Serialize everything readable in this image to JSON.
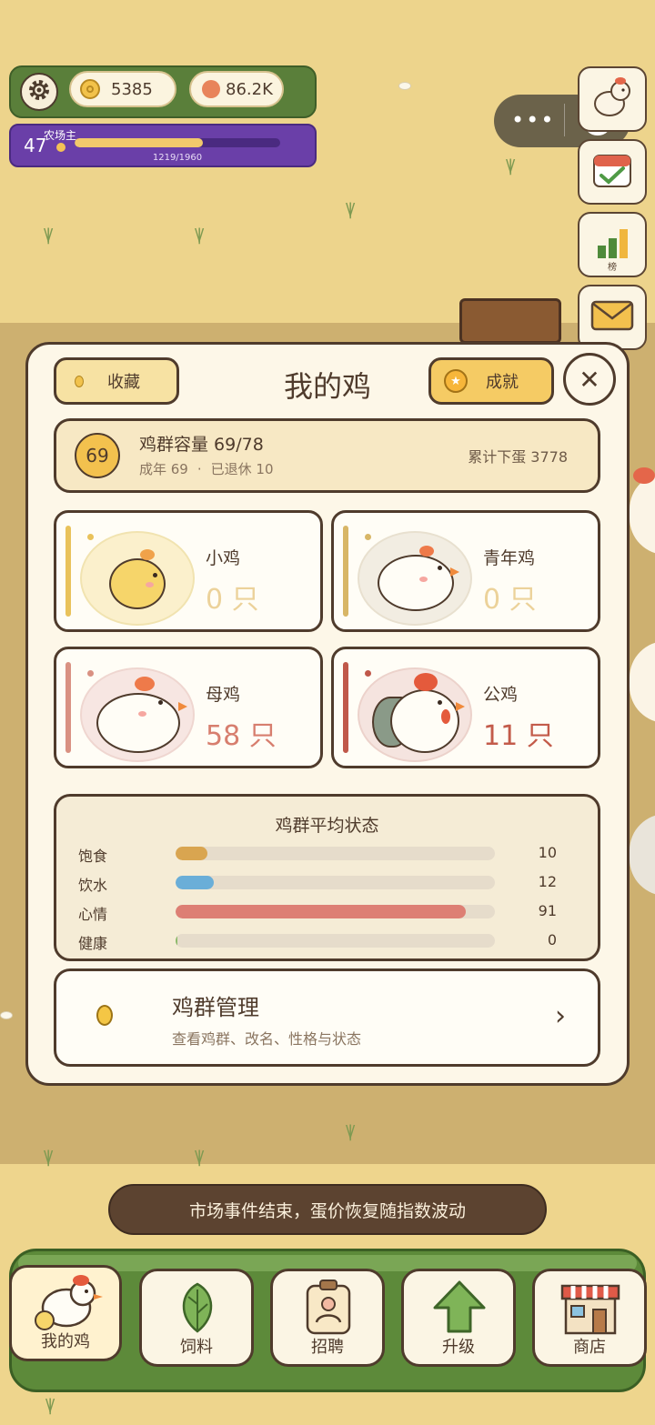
{
  "hud": {
    "coins": "5385",
    "eggs": "86.2K",
    "level": "47",
    "level_title": "农场主",
    "xp_text": "1219/1960",
    "xp_progress": 0.622
  },
  "side": {
    "rank_label": "榜"
  },
  "panel": {
    "title": "我的鸡",
    "favorites_label": "收藏",
    "achievements_label": "成就",
    "close_label": "✕"
  },
  "capacity": {
    "badge": "69",
    "title": "鸡群容量 69/78",
    "adult": "成年 69",
    "separator": "·",
    "retired": "已退休 10",
    "total_eggs": "累计下蛋 3778"
  },
  "types": [
    {
      "name": "小鸡",
      "count": "0 只",
      "accent": "#e9c25a",
      "count_color": "#ecd29a"
    },
    {
      "name": "青年鸡",
      "count": "0 只",
      "accent": "#d8b666",
      "count_color": "#ecd29a"
    },
    {
      "name": "母鸡",
      "count": "58 只",
      "accent": "#d99182",
      "count_color": "#d77e6e"
    },
    {
      "name": "公鸡",
      "count": "11 只",
      "accent": "#c0584a",
      "count_color": "#c35b4a"
    }
  ],
  "status": {
    "title": "鸡群平均状态",
    "stats": [
      {
        "label": "饱食",
        "value": "10",
        "fraction": 0.1,
        "color": "#d9a550"
      },
      {
        "label": "饮水",
        "value": "12",
        "fraction": 0.12,
        "color": "#6aaed8"
      },
      {
        "label": "心情",
        "value": "91",
        "fraction": 0.91,
        "color": "#dd7f74"
      },
      {
        "label": "健康",
        "value": "0",
        "fraction": 0.0,
        "color": "#8cba6a"
      }
    ]
  },
  "management": {
    "title": "鸡群管理",
    "subtitle": "查看鸡群、改名、性格与状态",
    "arrow": "›"
  },
  "toast": "市场事件结束，蛋价恢复随指数波动",
  "nav": {
    "items": [
      {
        "label": "我的鸡",
        "icon": "chicken-icon",
        "active": true
      },
      {
        "label": "饲料",
        "icon": "leaf-icon",
        "active": false
      },
      {
        "label": "招聘",
        "icon": "id-badge-icon",
        "active": false
      },
      {
        "label": "升级",
        "icon": "up-arrow-icon",
        "active": false
      },
      {
        "label": "商店",
        "icon": "shop-icon",
        "active": false
      }
    ]
  }
}
